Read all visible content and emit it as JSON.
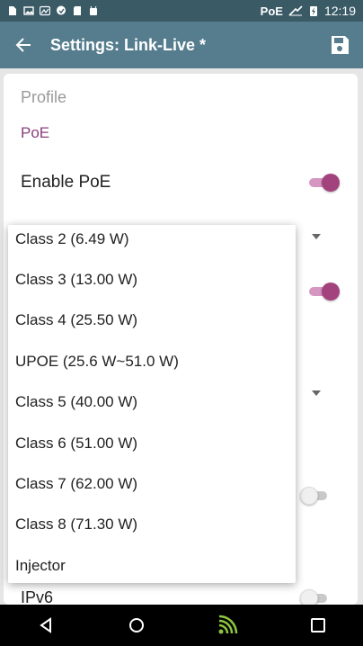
{
  "status_bar": {
    "poe_indicator": "PoE",
    "time": "12:19"
  },
  "app_bar": {
    "title": "Settings: Link-Live *"
  },
  "profile": {
    "heading": "Profile",
    "section": "PoE",
    "enable_poe_label": "Enable PoE",
    "enable_poe_on": true,
    "ipv6_label": "IPv6",
    "ipv6_on": false
  },
  "dropdown": {
    "options": [
      "Class 2 (6.49 W)",
      "Class 3 (13.00 W)",
      "Class 4 (25.50 W)",
      "UPOE (25.6 W~51.0 W)",
      "Class 5 (40.00 W)",
      "Class 6 (51.00 W)",
      "Class 7 (62.00 W)",
      "Class 8 (71.30 W)",
      "Injector"
    ]
  },
  "colors": {
    "status_bar": "#3a5a66",
    "app_bar": "#557d8e",
    "accent": "#a3437e"
  },
  "icons": {
    "back": "arrow-left-icon",
    "save": "floppy-disk-icon",
    "nav_back": "triangle-back-icon",
    "nav_home": "circle-home-icon",
    "nav_app": "wifi-signal-icon",
    "nav_recent": "square-recents-icon"
  }
}
